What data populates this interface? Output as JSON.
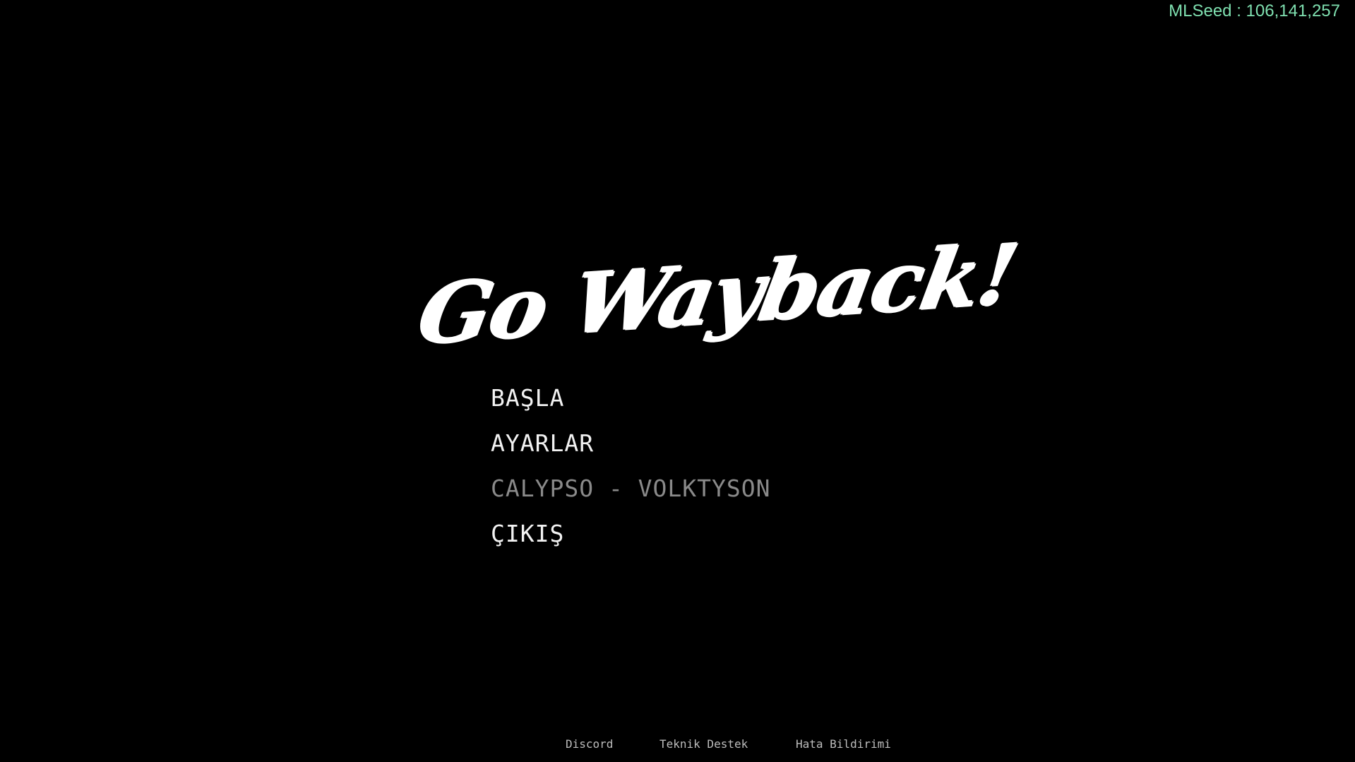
{
  "hud": {
    "seed_label": "MLSeed : 106,141,257"
  },
  "logo": {
    "title": "Go Wayback!"
  },
  "menu": {
    "items": [
      {
        "label": "BAŞLA"
      },
      {
        "label": "AYARLAR"
      },
      {
        "label": "CALYPSO - VOLKTYSON"
      },
      {
        "label": "ÇIKIŞ"
      }
    ]
  },
  "footer": {
    "links": [
      {
        "label": "Discord"
      },
      {
        "label": "Teknik Destek"
      },
      {
        "label": "Hata Bildirimi"
      }
    ]
  },
  "colors": {
    "background": "#000000",
    "seed_text": "#7fe0b0",
    "menu_text": "#f2f2f2",
    "menu_dim_text": "#8a8a8a",
    "footer_text": "#bdbdbd"
  }
}
